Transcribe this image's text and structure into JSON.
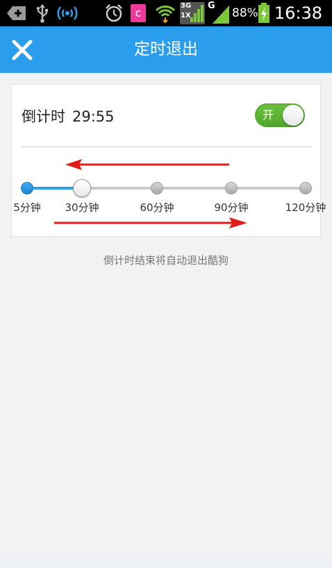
{
  "status_bar": {
    "time": "16:38",
    "battery_percent": "88%",
    "network_3g": "3G",
    "network_1x": "1X",
    "network_g": "G",
    "app_notification": "c",
    "icons": [
      "add-icon",
      "usb-icon",
      "wireless-hotspot-icon",
      "alarm-icon",
      "app-notification-icon",
      "wifi-icon",
      "signal-3g-icon",
      "signal-g-icon",
      "battery-charging-icon"
    ]
  },
  "header": {
    "title": "定时退出",
    "close_icon": "close-icon",
    "background_color": "#2a9ded"
  },
  "timer": {
    "label": "倒计时",
    "countdown": "29:55",
    "toggle_label": "开",
    "toggle_on": true,
    "toggle_color": "#5bb232"
  },
  "slider": {
    "options": [
      "5分钟",
      "30分钟",
      "60分钟",
      "90分钟",
      "120分钟"
    ],
    "selected_index": 1,
    "accent_color": "#2a9ded"
  },
  "hint": "倒计时结束将自动退出酷狗",
  "annotation_color": "#e21a1a"
}
